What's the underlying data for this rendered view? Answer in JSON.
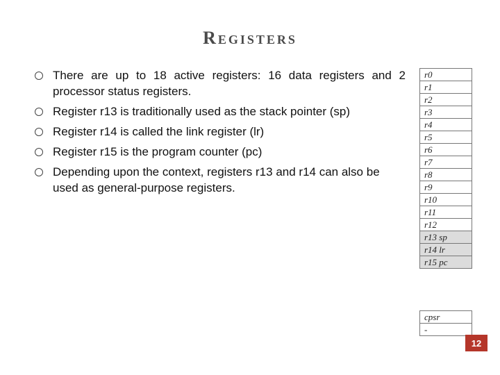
{
  "title": "Registers",
  "bullets": [
    "There are up to 18 active registers: 16 data registers and 2 processor status registers.",
    "Register r13 is traditionally used as the stack pointer (sp)",
    "Register r14 is called the link register (lr)",
    "Register r15 is the program counter (pc)",
    "Depending upon the context, registers r13 and r14 can also be used as general-purpose registers."
  ],
  "registers": [
    {
      "label": "r0",
      "shade": false,
      "italic": true
    },
    {
      "label": "r1",
      "shade": false,
      "italic": true
    },
    {
      "label": "r2",
      "shade": false,
      "italic": true
    },
    {
      "label": "r3",
      "shade": false,
      "italic": true
    },
    {
      "label": "r4",
      "shade": false,
      "italic": true
    },
    {
      "label": "r5",
      "shade": false,
      "italic": true
    },
    {
      "label": "r6",
      "shade": false,
      "italic": true
    },
    {
      "label": "r7",
      "shade": false,
      "italic": true
    },
    {
      "label": "r8",
      "shade": false,
      "italic": true
    },
    {
      "label": "r9",
      "shade": false,
      "italic": true
    },
    {
      "label": "r10",
      "shade": false,
      "italic": true
    },
    {
      "label": "r11",
      "shade": false,
      "italic": true
    },
    {
      "label": "r12",
      "shade": false,
      "italic": true
    },
    {
      "label": "r13 sp",
      "shade": true,
      "italic": true
    },
    {
      "label": "r14 lr",
      "shade": true,
      "italic": true
    },
    {
      "label": "r15 pc",
      "shade": true,
      "italic": true
    }
  ],
  "status_registers": [
    {
      "label": "cpsr",
      "italic": true
    },
    {
      "label": "-",
      "italic": false
    }
  ],
  "page_number": "12"
}
